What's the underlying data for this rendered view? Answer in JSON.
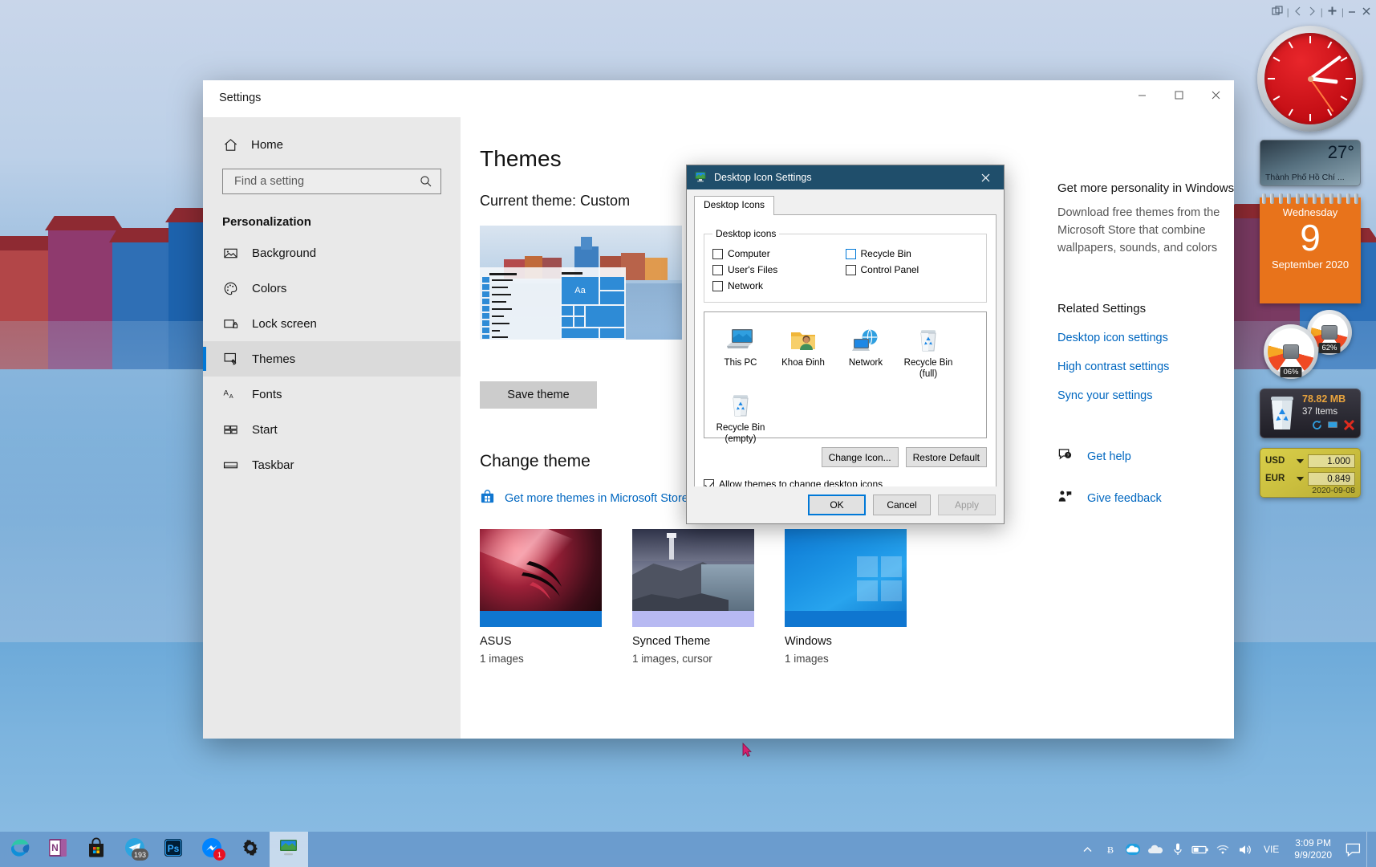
{
  "settings_window": {
    "title": "Settings",
    "window_controls": {
      "minimize": "—",
      "maximize": "☐",
      "close": "✕"
    },
    "sidebar": {
      "home_label": "Home",
      "home_icon": "home-icon",
      "search": {
        "placeholder": "Find a setting",
        "value": "",
        "icon": "search-icon"
      },
      "section_label": "Personalization",
      "items": [
        {
          "label": "Background",
          "icon": "image-icon",
          "selected": false
        },
        {
          "label": "Colors",
          "icon": "palette-icon",
          "selected": false
        },
        {
          "label": "Lock screen",
          "icon": "lock-screen-icon",
          "selected": false
        },
        {
          "label": "Themes",
          "icon": "brush-icon",
          "selected": true
        },
        {
          "label": "Fonts",
          "icon": "fonts-icon",
          "selected": false
        },
        {
          "label": "Start",
          "icon": "start-icon",
          "selected": false
        },
        {
          "label": "Taskbar",
          "icon": "taskbar-icon",
          "selected": false
        }
      ]
    },
    "main": {
      "page_title": "Themes",
      "current_theme": "Current theme: Custom",
      "preview_tile_text": "Aa",
      "save_theme_label": "Save theme",
      "change_theme_heading": "Change theme",
      "store_link": "Get more themes in Microsoft Store",
      "store_icon": "microsoft-store-icon",
      "themes": [
        {
          "name": "ASUS",
          "meta": "1 images",
          "accent": "#0f76d0"
        },
        {
          "name": "Synced Theme",
          "meta": "1 images, cursor",
          "accent": "#b7b9f2"
        },
        {
          "name": "Windows",
          "meta": "1 images",
          "accent": "#0f76d0"
        }
      ]
    },
    "side_panel": {
      "heading": "Get more personality in Windows",
      "paragraph": "Download free themes from the Microsoft Store that combine wallpapers, sounds, and colors",
      "related_heading": "Related Settings",
      "links": [
        "Desktop icon settings",
        "High contrast settings",
        "Sync your settings"
      ],
      "help": [
        {
          "label": "Get help",
          "icon": "help-icon"
        },
        {
          "label": "Give feedback",
          "icon": "feedback-icon"
        }
      ]
    }
  },
  "dialog": {
    "title": "Desktop Icon Settings",
    "title_icon": "monitor-icon",
    "close_label": "✕",
    "tabs": [
      {
        "label": "Desktop Icons",
        "active": true
      }
    ],
    "group_label": "Desktop icons",
    "checkboxes": [
      {
        "label": "Computer",
        "checked": false,
        "focused": false
      },
      {
        "label": "Recycle Bin",
        "checked": false,
        "focused": true
      },
      {
        "label": "User's Files",
        "checked": false,
        "focused": false
      },
      {
        "label": "Control Panel",
        "checked": false,
        "focused": false
      },
      {
        "label": "Network",
        "checked": false,
        "focused": false
      }
    ],
    "preview_icons": [
      {
        "label": "This PC",
        "icon": "this-pc-icon"
      },
      {
        "label": "Khoa Đinh",
        "icon": "user-folder-icon"
      },
      {
        "label": "Network",
        "icon": "network-icon"
      },
      {
        "label": "Recycle Bin\n(full)",
        "icon": "recycle-bin-full-icon"
      },
      {
        "label": "Recycle Bin\n(empty)",
        "icon": "recycle-bin-empty-icon"
      }
    ],
    "preview_icon_labels": {
      "this_pc": "This PC",
      "user": "Khoa Đinh",
      "network": "Network",
      "bin_full_l1": "Recycle Bin",
      "bin_full_l2": "(full)",
      "bin_empty_l1": "Recycle Bin",
      "bin_empty_l2": "(empty)"
    },
    "change_icon_label": "Change Icon...",
    "restore_default_label": "Restore Default",
    "allow_themes_label": "Allow themes to change desktop icons",
    "allow_themes_checked": true,
    "footer": {
      "ok": "OK",
      "cancel": "Cancel",
      "apply": "Apply",
      "apply_disabled": true
    }
  },
  "gadgets": {
    "toolbar_icons": [
      "gadget-add-icon",
      "prev-icon",
      "next-icon",
      "add-icon",
      "minimize-icon",
      "close-icon"
    ],
    "clock": {
      "name": "clock-gadget",
      "hour_deg": 97,
      "minute_deg": 54,
      "second_deg": 145
    },
    "weather": {
      "temperature": "27°",
      "city": "Thành Phố Hồ Chí ..."
    },
    "calendar": {
      "weekday": "Wednesday",
      "day": "9",
      "month_year": "September 2020"
    },
    "meters": {
      "cpu": "06%",
      "memory": "62%"
    },
    "recycle_bin": {
      "size": "78.82 MB",
      "items": "37 Items",
      "actions": [
        "refresh-icon",
        "open-icon",
        "empty-icon"
      ]
    },
    "currency": {
      "rows": [
        {
          "code": "USD",
          "value": "1.000"
        },
        {
          "code": "EUR",
          "value": "0.849"
        }
      ],
      "date": "2020-09-08"
    }
  },
  "taskbar": {
    "apps": [
      {
        "name": "edge-icon",
        "badge": null,
        "active": false
      },
      {
        "name": "onenote-icon",
        "badge": null,
        "active": false
      },
      {
        "name": "store-icon",
        "badge": null,
        "active": false
      },
      {
        "name": "telegram-icon",
        "badge": "193",
        "active": false
      },
      {
        "name": "photoshop-icon",
        "badge": null,
        "active": false
      },
      {
        "name": "messenger-icon",
        "badge": "1",
        "active": false
      },
      {
        "name": "settings-gear-icon",
        "badge": null,
        "active": false
      },
      {
        "name": "desktop-icon-settings-icon",
        "badge": null,
        "active": true
      }
    ],
    "tray": [
      "chevron-up-icon",
      "unikey-icon",
      "onedrive-icon",
      "cloud-icon",
      "microphone-icon",
      "battery-icon",
      "wifi-icon",
      "volume-icon"
    ],
    "language": "VIE",
    "time": "3:09 PM",
    "date": "9/9/2020",
    "action_center_icon": "action-center-icon"
  }
}
